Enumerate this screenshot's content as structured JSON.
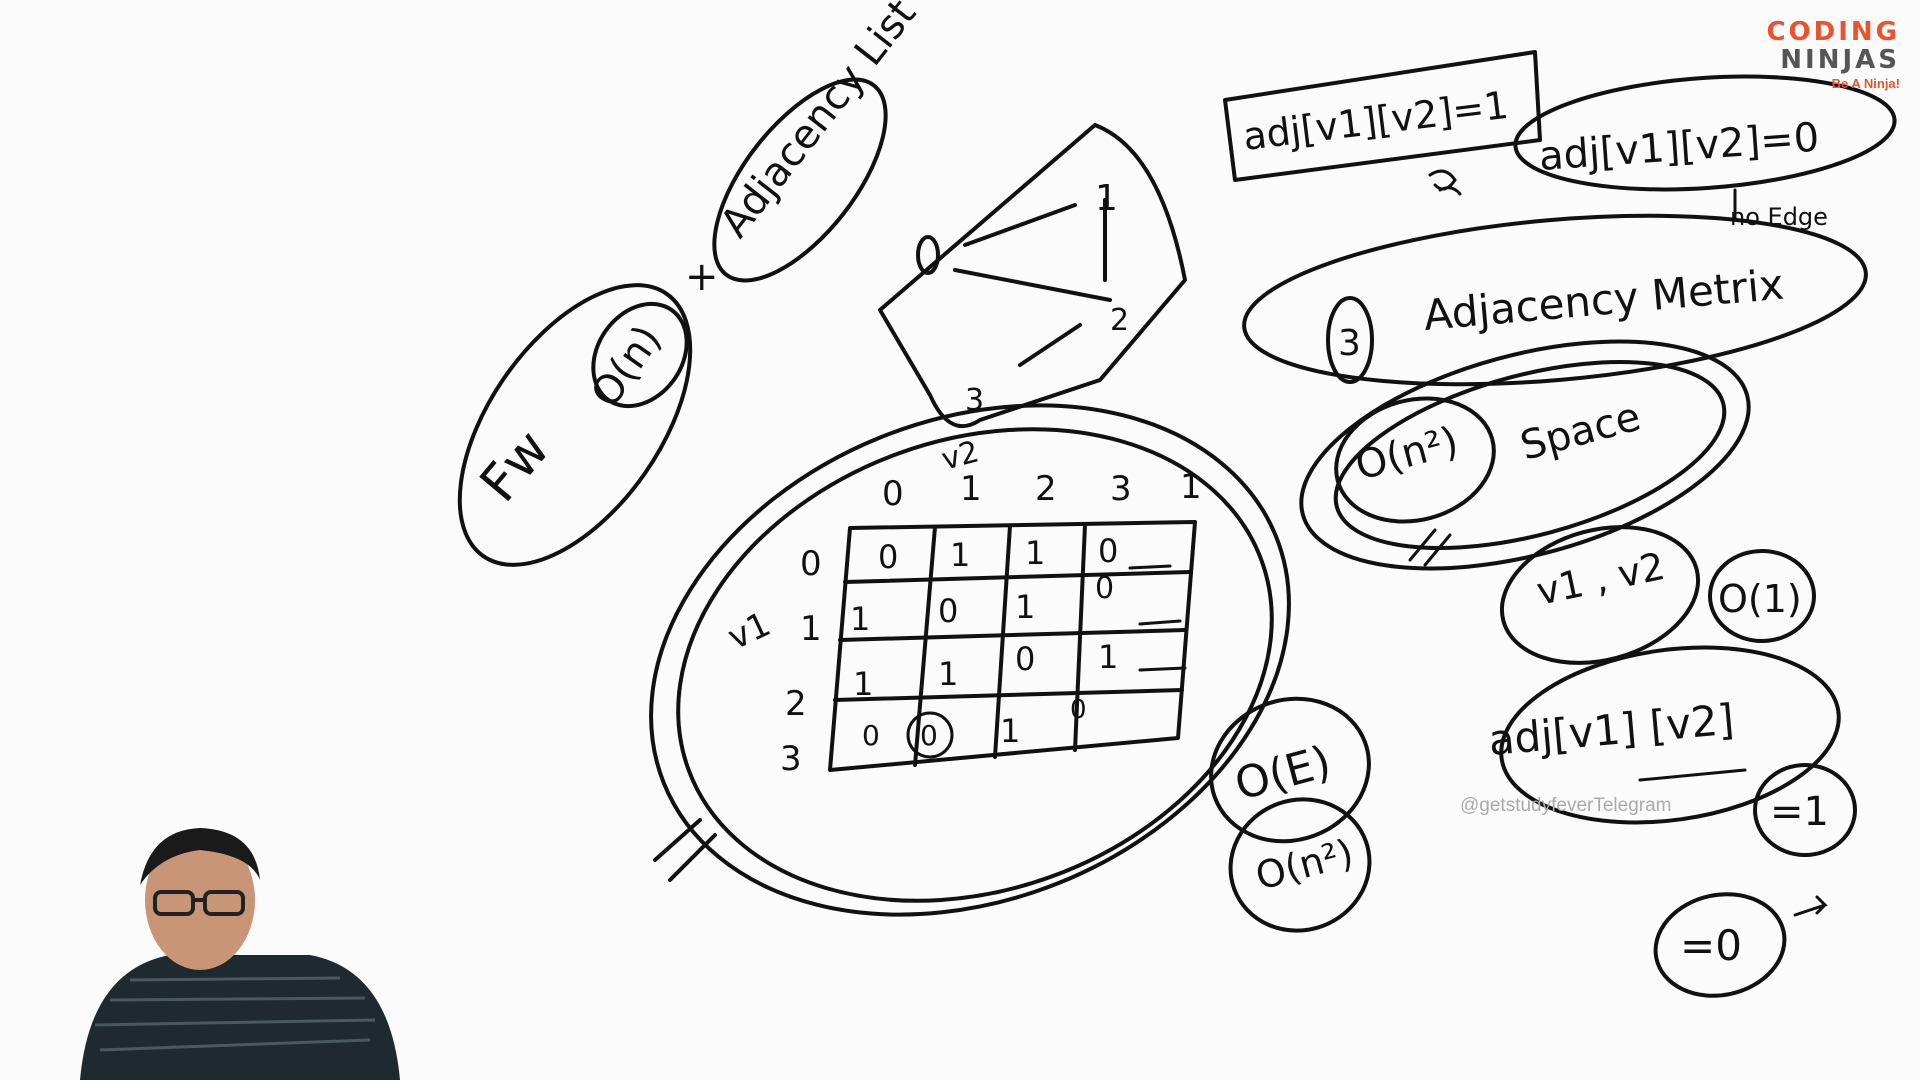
{
  "whiteboard": {
    "adjacency_list_label": "Adjacency List",
    "fw_label": "Fw",
    "on_label": "O(n)",
    "plus_sign": "+",
    "eq_one": "adj[v1][v2]=1",
    "eq_zero": "adj[v1][v2]=0",
    "no_edge_label": "no Edge",
    "adjacency_matrix_label": "Adjacency Metrix",
    "step_number": "3",
    "on2_space": "O(n²)",
    "space_label": "Space",
    "v1v2_label": "v1 , v2",
    "o1_label": "O(1)",
    "adj_expr": "adj[v1] [v2]",
    "eq1_small": "=1",
    "eq0_small": "=0",
    "oe_label": "O(E)",
    "on2_small": "O(n²)",
    "v2_label": "v2",
    "v1_label": "v1",
    "graph_nodes": [
      "0",
      "1",
      "2",
      "3"
    ],
    "matrix": {
      "col_headers": [
        "0",
        "1",
        "2",
        "3"
      ],
      "row_headers": [
        "0",
        "1",
        "2",
        "3"
      ],
      "rows": [
        [
          "0",
          "1",
          "1",
          "0"
        ],
        [
          "1",
          "0",
          "1",
          "0"
        ],
        [
          "1",
          "1",
          "0",
          "1"
        ],
        [
          "0",
          "0",
          "1",
          "0"
        ]
      ]
    }
  },
  "watermark": "@getstudyfeverTelegram",
  "logo": {
    "line1": "CODING",
    "line2": "NINJAS",
    "tagline": "Be A Ninja!"
  }
}
